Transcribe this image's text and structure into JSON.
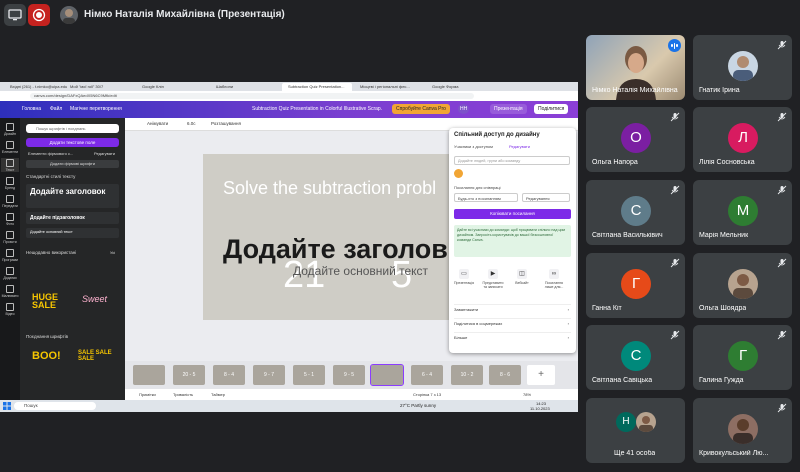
{
  "topbar": {
    "presenter_label": "Німко Наталія Михайлівна (Презентація)"
  },
  "browser": {
    "tabs": [
      "Вхідні (261) - t.nimko@uipa.edu",
      "Мой \"мої roll\" 30/7",
      "Google Кліп",
      "Шаблони",
      "Subtraction Quiz Presentation...",
      "Місцеві і регіональні фес...",
      "Google Форма"
    ],
    "url": "canva.com/design/DAFxQAedX5N6C9Mfk/edit"
  },
  "canva_top": {
    "home": "Головна",
    "file": "Файл",
    "resize": "Магічне перетворення",
    "doc_title": "Subtraction Quiz Presentation in Colorful Illustrative Scrap...",
    "try_pro": "Спробуйте Canva Pro",
    "avatar_initials": "НН",
    "present": "Презентація",
    "share": "Поділитися"
  },
  "rail": [
    "Дизайн",
    "Елементи",
    "Текст",
    "Бренд",
    "Передати",
    "Фото",
    "Проєкти",
    "Програми",
    "Додатки",
    "Малювати",
    "Відео"
  ],
  "panel": {
    "search_placeholder": "Пошук шрифтів і поєднань",
    "add_textbox": "Додати текстове поле",
    "chip1": "Елементи фірмового с...",
    "chip2": "Редагувати",
    "brand_fonts": "Додати фірмові шрифти",
    "default_styles": "Стандартні стилі тексту",
    "add_heading": "Додайте заголовок",
    "add_subheading": "Додайте підзаголовок",
    "add_body": "Додайте основний текст",
    "recent": "Нещодавно використані",
    "recent_all": "Усі",
    "combos": "Поєднання шрифтів",
    "sample_huge": "HUGE",
    "sample_sale": "SALE",
    "sample_sweet": "Sweet",
    "sample_boo": "BOO!",
    "sample_sale2": "SALE SALE SALE"
  },
  "editor_toolbar": {
    "animate": "Анімувати",
    "time": "6.0с",
    "position": "Розташування"
  },
  "slide": {
    "title": "Solve the subtraction probl",
    "heading": "Додайте заголов",
    "subtext": "Додайте основний текст",
    "num_left": "21",
    "num_right": "5"
  },
  "filmstrip": {
    "thumbs": [
      "",
      "20 - 5",
      "8 - 4",
      "9 - 7",
      "5 - 1",
      "9 - 5",
      "",
      "6 - 4",
      "10 - 2",
      "8 - 6"
    ],
    "selected_index": 6,
    "add": "+"
  },
  "editor_status": {
    "notes": "Примітки",
    "duration": "Тривалість",
    "timer": "Таймер",
    "page": "Сторінка 7 з 13",
    "zoom": "78%"
  },
  "share_panel": {
    "title": "Спільний доступ до дизайну",
    "people_label": "Учасники з доступом",
    "edit_link": "Редагувати",
    "input_placeholder": "Додайте людей, групи або команду",
    "share_link_label": "Посилання для співпраці",
    "access_value": "Будь-хто з посиланням",
    "permission_value": "Редагування",
    "copy_button": "Копіювати посилання",
    "green_text": "Дайте всі учасники до команди: щоб працювати спільно над цим дизайном. Запросіть користувачів до вашої безкоштовної команди Canva.",
    "icons": [
      {
        "icon": "presentation-icon",
        "label": "Презентація"
      },
      {
        "icon": "video-icon",
        "label": "Представити та записати"
      },
      {
        "icon": "website-icon",
        "label": "Вебсайт"
      },
      {
        "icon": "link-icon",
        "label": "Посилання лише для..."
      }
    ],
    "rows": [
      "Завантажити",
      "Поділитися в соцмережах",
      "Більше"
    ]
  },
  "taskbar": {
    "search": "Пошук",
    "weather": "27°C Partly sunny",
    "time": "14:23",
    "date": "11.10.2023"
  },
  "participants": [
    {
      "name": "Німко Наталія Михайлівна",
      "type": "video",
      "speaking": true
    },
    {
      "name": "Гнатик Ірина",
      "type": "photo"
    },
    {
      "name": "Ольга Напора",
      "initial": "О",
      "color": "#7b1fa2"
    },
    {
      "name": "Лілія Сосновська",
      "initial": "Л",
      "color": "#d81b60"
    },
    {
      "name": "Світлана Васильківич",
      "initial": "С",
      "color": "#5f7c8a"
    },
    {
      "name": "Марія Мельник",
      "initial": "М",
      "color": "#2e7d32"
    },
    {
      "name": "Ганна Кіт",
      "initial": "Г",
      "color": "#e64a19"
    },
    {
      "name": "Ольга Шоядра",
      "type": "photo"
    },
    {
      "name": "Світлана Савіцька",
      "initial": "С",
      "color": "#00897b"
    },
    {
      "name": "Галина Гужда",
      "initial": "Г",
      "color": "#2e7d32"
    },
    {
      "name": "Ще 41 особа",
      "type": "more",
      "initial": "Н"
    },
    {
      "name": "Кривокульський Лю...",
      "type": "photo"
    }
  ]
}
